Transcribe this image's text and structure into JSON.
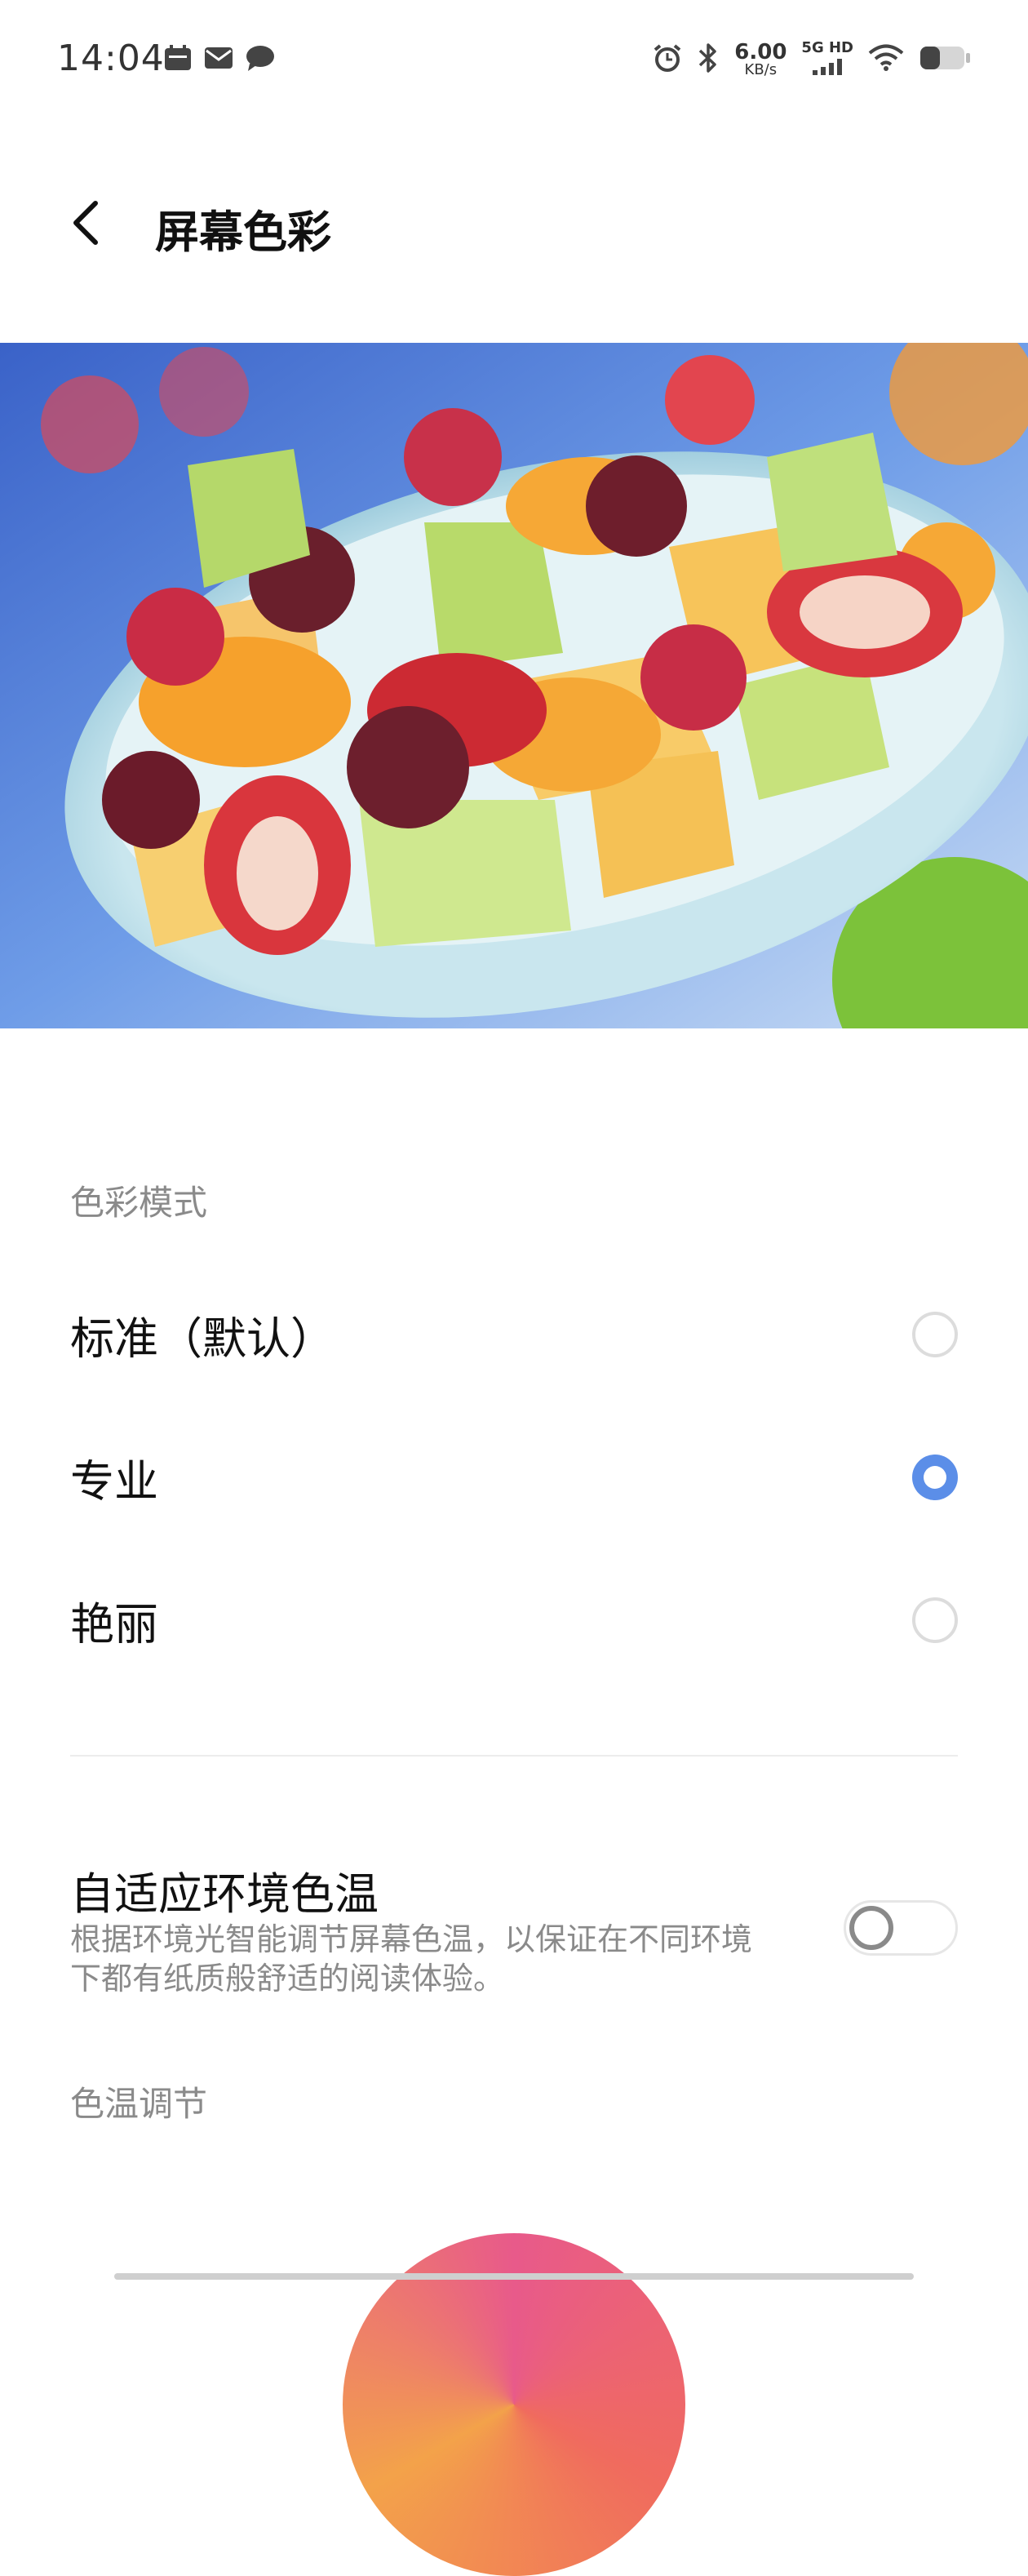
{
  "status_bar": {
    "time": "14:04",
    "net_speed": "6.00",
    "net_unit": "KB/s",
    "net_type": "5G HD",
    "left_icons": [
      "calendar-icon",
      "mail-icon",
      "chat-icon"
    ],
    "right_icons": [
      "alarm-icon",
      "bluetooth-icon",
      "signal-icon",
      "wifi-icon",
      "battery-icon"
    ]
  },
  "header": {
    "title": "屏幕色彩",
    "back_icon": "chevron-left-icon"
  },
  "preview": {
    "description_icon": "fruit-salad-preview"
  },
  "color_mode": {
    "section_label": "色彩模式",
    "options": [
      {
        "label": "标准（默认）",
        "selected": false
      },
      {
        "label": "专业",
        "selected": true
      },
      {
        "label": "艳丽",
        "selected": false
      }
    ]
  },
  "adaptive": {
    "title": "自适应环境色温",
    "description": "根据环境光智能调节屏幕色温，以保证在不同环境下都有纸质般舒适的阅读体验。",
    "enabled": false
  },
  "temperature": {
    "section_label": "色温调节"
  },
  "colors": {
    "accent": "#5b8ee8",
    "secondary_text": "#8a8a8a"
  }
}
